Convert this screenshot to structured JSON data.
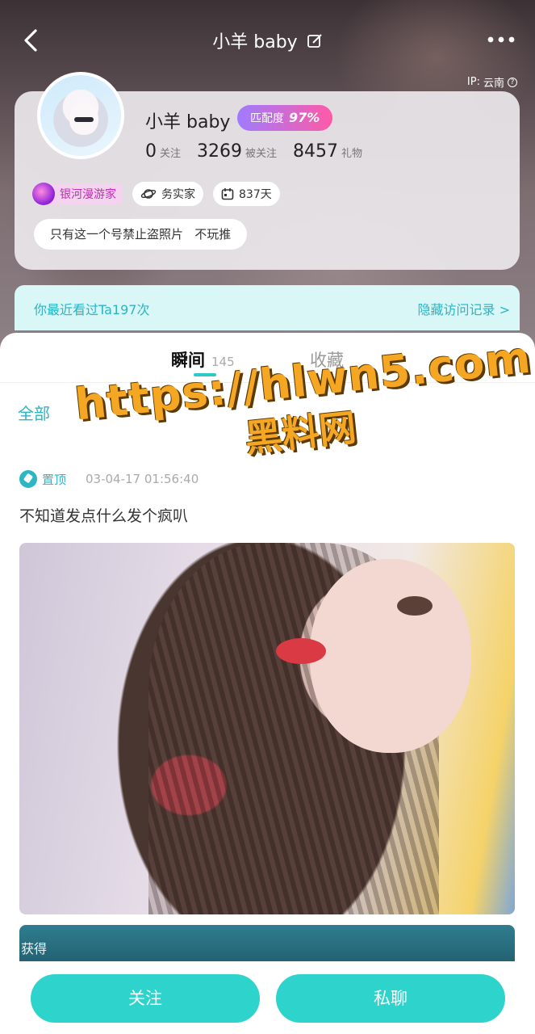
{
  "nav": {
    "title": "小羊 baby"
  },
  "ip": {
    "label": "IP:",
    "location": "云南"
  },
  "profile": {
    "name": "小羊 baby",
    "match_label": "匹配度",
    "match_value": "97%",
    "stats": [
      {
        "value": "0",
        "label": "关注"
      },
      {
        "value": "3269",
        "label": "被关注"
      },
      {
        "value": "8457",
        "label": "礼物"
      }
    ],
    "tags": [
      {
        "icon": "galaxy-badge-icon",
        "label": "银河漫游家"
      },
      {
        "icon": "planet-icon",
        "label": "务实家"
      },
      {
        "icon": "calendar-icon",
        "label": "837天"
      }
    ],
    "bio": "只有这一个号禁止盗照片   不玩推"
  },
  "visit": {
    "text": "你最近看过Ta197次",
    "action": "隐藏访问记录 >"
  },
  "tabs": [
    {
      "label": "瞬间",
      "count": "145"
    },
    {
      "label": "收藏"
    }
  ],
  "filter": {
    "all": "全部"
  },
  "post": {
    "pinned": "置顶",
    "time": "03-04-17 01:56:40",
    "text": "不知道发点什么发个疯叭"
  },
  "second_post": {
    "label": "获得"
  },
  "watermark": {
    "url": "https://hlwn5.com",
    "name": "黑料网"
  },
  "actions": {
    "follow": "关注",
    "chat": "私聊"
  },
  "colors": {
    "accent": "#2ed3cc",
    "link": "#2bb5c5",
    "match_gradient_start": "#9f7bff",
    "match_gradient_end": "#ff5aa6"
  }
}
